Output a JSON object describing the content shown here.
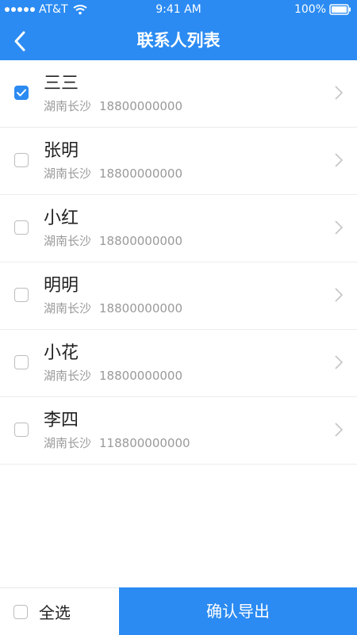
{
  "status_bar": {
    "carrier": "AT&T",
    "time": "9:41 AM",
    "battery": "100%"
  },
  "header": {
    "title": "联系人列表"
  },
  "contacts": [
    {
      "name": "三三",
      "location": "湖南长沙",
      "phone": "18800000000",
      "checked": true
    },
    {
      "name": "张明",
      "location": "湖南长沙",
      "phone": "18800000000",
      "checked": false
    },
    {
      "name": "小红",
      "location": "湖南长沙",
      "phone": "18800000000",
      "checked": false
    },
    {
      "name": "明明",
      "location": "湖南长沙",
      "phone": "18800000000",
      "checked": false
    },
    {
      "name": "小花",
      "location": "湖南长沙",
      "phone": "18800000000",
      "checked": false
    },
    {
      "name": "李四",
      "location": "湖南长沙",
      "phone": "118800000000",
      "checked": false
    }
  ],
  "footer": {
    "select_all_label": "全选",
    "export_label": "确认导出"
  },
  "colors": {
    "accent": "#2b8bf2",
    "text": "#222222",
    "muted": "#9a9a9a"
  },
  "icons": {
    "back": "back-icon",
    "chevron": "chevron-right-icon",
    "check": "check-icon",
    "wifi": "wifi-icon",
    "battery": "battery-icon",
    "signal": "signal-icon"
  }
}
